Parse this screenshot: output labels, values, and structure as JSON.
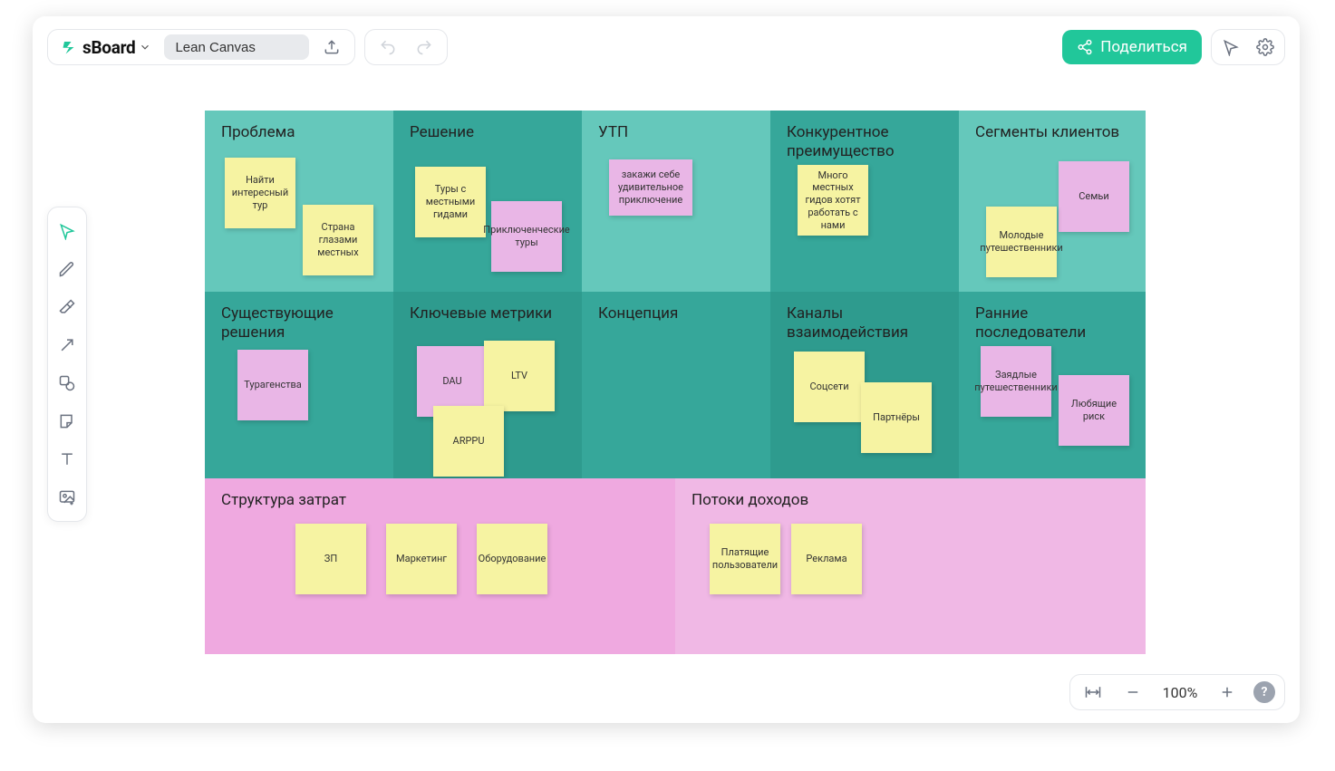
{
  "app": {
    "brand": "sBoard"
  },
  "header": {
    "title": "Lean Canvas",
    "share_label": "Поделиться"
  },
  "zoom": {
    "level": "100%"
  },
  "colors": {
    "accent": "#21c79a",
    "teal1": "#65c8bb",
    "teal2": "#36a79a",
    "teal3": "#2e9b8e",
    "pink1": "#efa9e0",
    "pink2": "#f0b8e5",
    "sticky_yellow": "#f6f3a2",
    "sticky_pink": "#e9b6e6"
  },
  "sections": {
    "problem": {
      "title": "Проблема",
      "stickies": [
        {
          "text": "Найти интересный тур",
          "color": "yellow"
        },
        {
          "text": "Страна глазами местных",
          "color": "yellow"
        }
      ]
    },
    "solution": {
      "title": "Решение",
      "stickies": [
        {
          "text": "Туры с местными гидами",
          "color": "yellow"
        },
        {
          "text": "Приключенческие туры",
          "color": "pink"
        }
      ]
    },
    "uvp": {
      "title": "УТП",
      "stickies": [
        {
          "text": "закажи себе удивительное приключение",
          "color": "pink"
        }
      ]
    },
    "advantage": {
      "title": "Конкурентное преимущество",
      "stickies": [
        {
          "text": "Много местных гидов хотят работать с нами",
          "color": "yellow"
        }
      ]
    },
    "customers": {
      "title": "Сегменты клиентов",
      "stickies": [
        {
          "text": "Семьи",
          "color": "pink"
        },
        {
          "text": "Молодые путешественники",
          "color": "yellow"
        }
      ]
    },
    "existing": {
      "title": "Существующие решения",
      "stickies": [
        {
          "text": "Турагенства",
          "color": "pink"
        }
      ]
    },
    "metrics": {
      "title": "Ключевые метрики",
      "stickies": [
        {
          "text": "DAU",
          "color": "pink"
        },
        {
          "text": "LTV",
          "color": "yellow"
        },
        {
          "text": "ARPPU",
          "color": "yellow"
        }
      ]
    },
    "concept": {
      "title": "Концепция",
      "stickies": []
    },
    "channels": {
      "title": "Каналы взаимодействия",
      "stickies": [
        {
          "text": "Соцсети",
          "color": "yellow"
        },
        {
          "text": "Партнёры",
          "color": "yellow"
        }
      ]
    },
    "early": {
      "title": "Ранние последователи",
      "stickies": [
        {
          "text": "Заядлые путешественники",
          "color": "pink"
        },
        {
          "text": "Любящие риск",
          "color": "pink"
        }
      ]
    },
    "costs": {
      "title": "Структура затрат",
      "stickies": [
        {
          "text": "ЗП",
          "color": "yellow"
        },
        {
          "text": "Маркетинг",
          "color": "yellow"
        },
        {
          "text": "Оборудование",
          "color": "yellow"
        }
      ]
    },
    "revenue": {
      "title": "Потоки доходов",
      "stickies": [
        {
          "text": "Платящие пользователи",
          "color": "yellow"
        },
        {
          "text": "Реклама",
          "color": "yellow"
        }
      ]
    }
  }
}
